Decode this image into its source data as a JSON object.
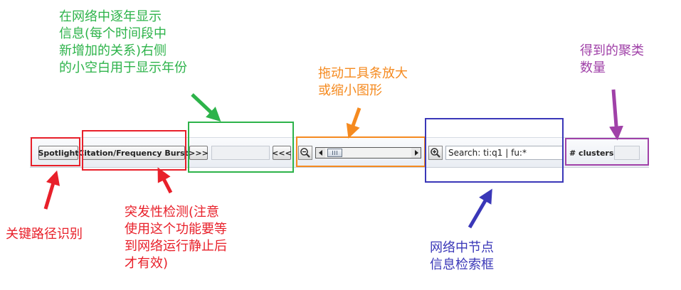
{
  "toolbar": {
    "spotlight_label": "Spotlight",
    "burst_label": "Citation/Frequency Burst",
    "forward_label": ">>>",
    "back_label": "<<<",
    "year_value": "",
    "search_value": "Search: ti:q1 | fu:*",
    "clusters_label": "# clusters",
    "clusters_value": ""
  },
  "annotations": {
    "year_display": [
      "在网络中逐年显示",
      "信息(每个时间段中",
      "新增加的关系)右侧",
      "的小空白用于显示年份"
    ],
    "zoom_slider": [
      "拖动工具条放大",
      "或缩小图形"
    ],
    "cluster_count": [
      "得到的聚类",
      "数量"
    ],
    "critical_path": [
      "关键路径识别"
    ],
    "burst_detection": [
      "突发性检测(注意",
      "使用这个功能要等",
      "到网络运行静止后",
      "才有效)"
    ],
    "node_search": [
      "网络中节点",
      "信息检索框"
    ]
  },
  "colors": {
    "red": "#e8202a",
    "green": "#2db34a",
    "orange": "#f58a1f",
    "blue": "#3a37b8",
    "purple": "#a041a8"
  },
  "icons": [
    "zoom-out-icon",
    "zoom-in-icon",
    "scroll-left-icon",
    "scroll-right-icon"
  ]
}
